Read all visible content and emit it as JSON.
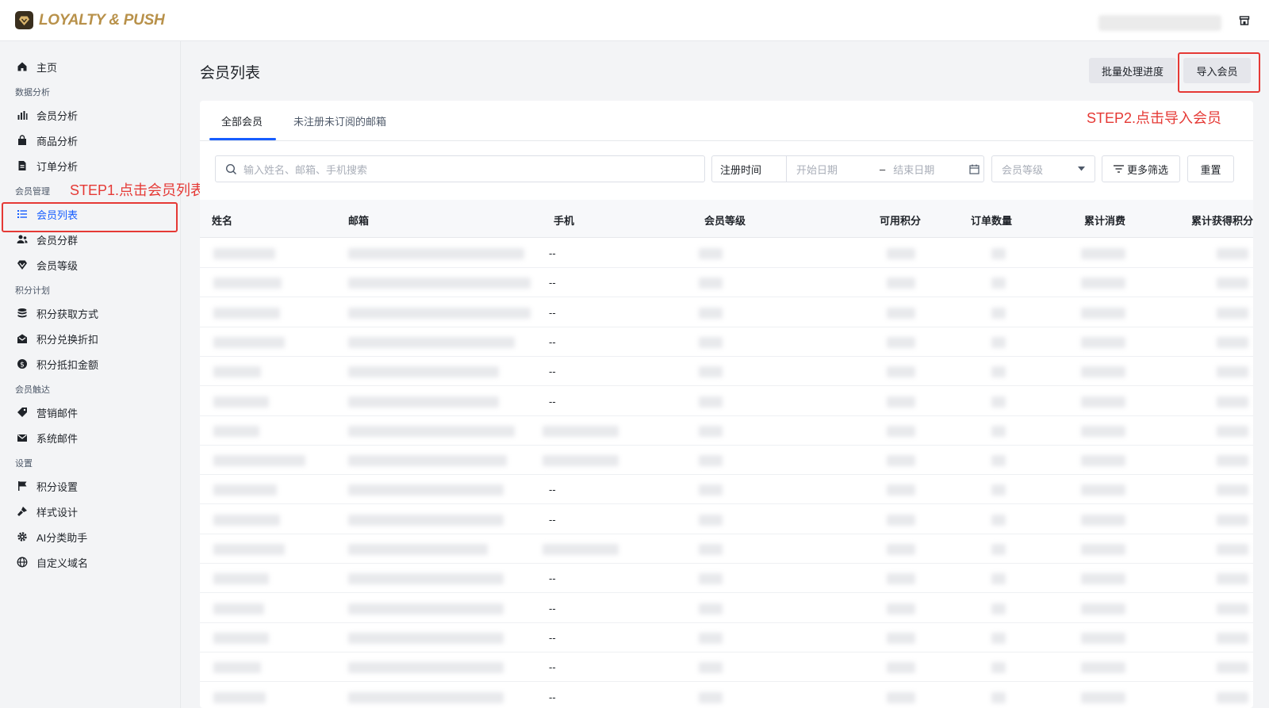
{
  "app": {
    "logo_text": "LOYALTY & PUSH",
    "brand_color": "#b8914a",
    "accent_color": "#165dff",
    "annotation_color": "#e53935"
  },
  "sidebar": {
    "home": "主页",
    "groups": {
      "analytics": "数据分析",
      "members": "会员管理",
      "points": "积分计划",
      "reach": "会员触达",
      "settings": "设置"
    },
    "items": {
      "member_analysis": "会员分析",
      "product_analysis": "商品分析",
      "order_analysis": "订单分析",
      "member_list": "会员列表",
      "member_segments": "会员分群",
      "member_levels": "会员等级",
      "points_earn": "积分获取方式",
      "points_redeem": "积分兑换折扣",
      "points_deduct": "积分抵扣金额",
      "marketing_mail": "营销邮件",
      "system_mail": "系统邮件",
      "points_settings": "积分设置",
      "style_design": "样式设计",
      "ai_assistant": "AI分类助手",
      "custom_domain": "自定义域名"
    },
    "active_item": "member_list"
  },
  "header": {
    "title": "会员列表",
    "batch_button": "批量处理进度",
    "import_button": "导入会员"
  },
  "annotations": {
    "step1": "STEP1.点击会员列表",
    "step2": "STEP2.点击导入会员"
  },
  "tabs": {
    "all_members": "全部会员",
    "unsubscribed": "未注册未订阅的邮箱"
  },
  "filters": {
    "search_placeholder": "输入姓名、邮箱、手机搜索",
    "date_type": "注册时间",
    "start_placeholder": "开始日期",
    "end_placeholder": "结束日期",
    "level_placeholder": "会员等级",
    "more_filters": "更多筛选",
    "reset": "重置"
  },
  "table": {
    "columns": {
      "name": "姓名",
      "email": "邮箱",
      "phone": "手机",
      "level": "会员等级",
      "points": "可用积分",
      "orders": "订单数量",
      "spend": "累计消费",
      "earned": "累计获得积分"
    },
    "rows": [
      {
        "phone": "--"
      },
      {
        "phone": "--"
      },
      {
        "phone": "--"
      },
      {
        "phone": "--"
      },
      {
        "phone": "--"
      },
      {
        "phone": "--"
      },
      {
        "phone": ""
      },
      {
        "phone": ""
      },
      {
        "phone": "--"
      },
      {
        "phone": "--"
      },
      {
        "phone": ""
      },
      {
        "phone": "--"
      },
      {
        "phone": "--"
      },
      {
        "phone": "--"
      },
      {
        "phone": "--"
      },
      {
        "phone": "--"
      }
    ]
  }
}
